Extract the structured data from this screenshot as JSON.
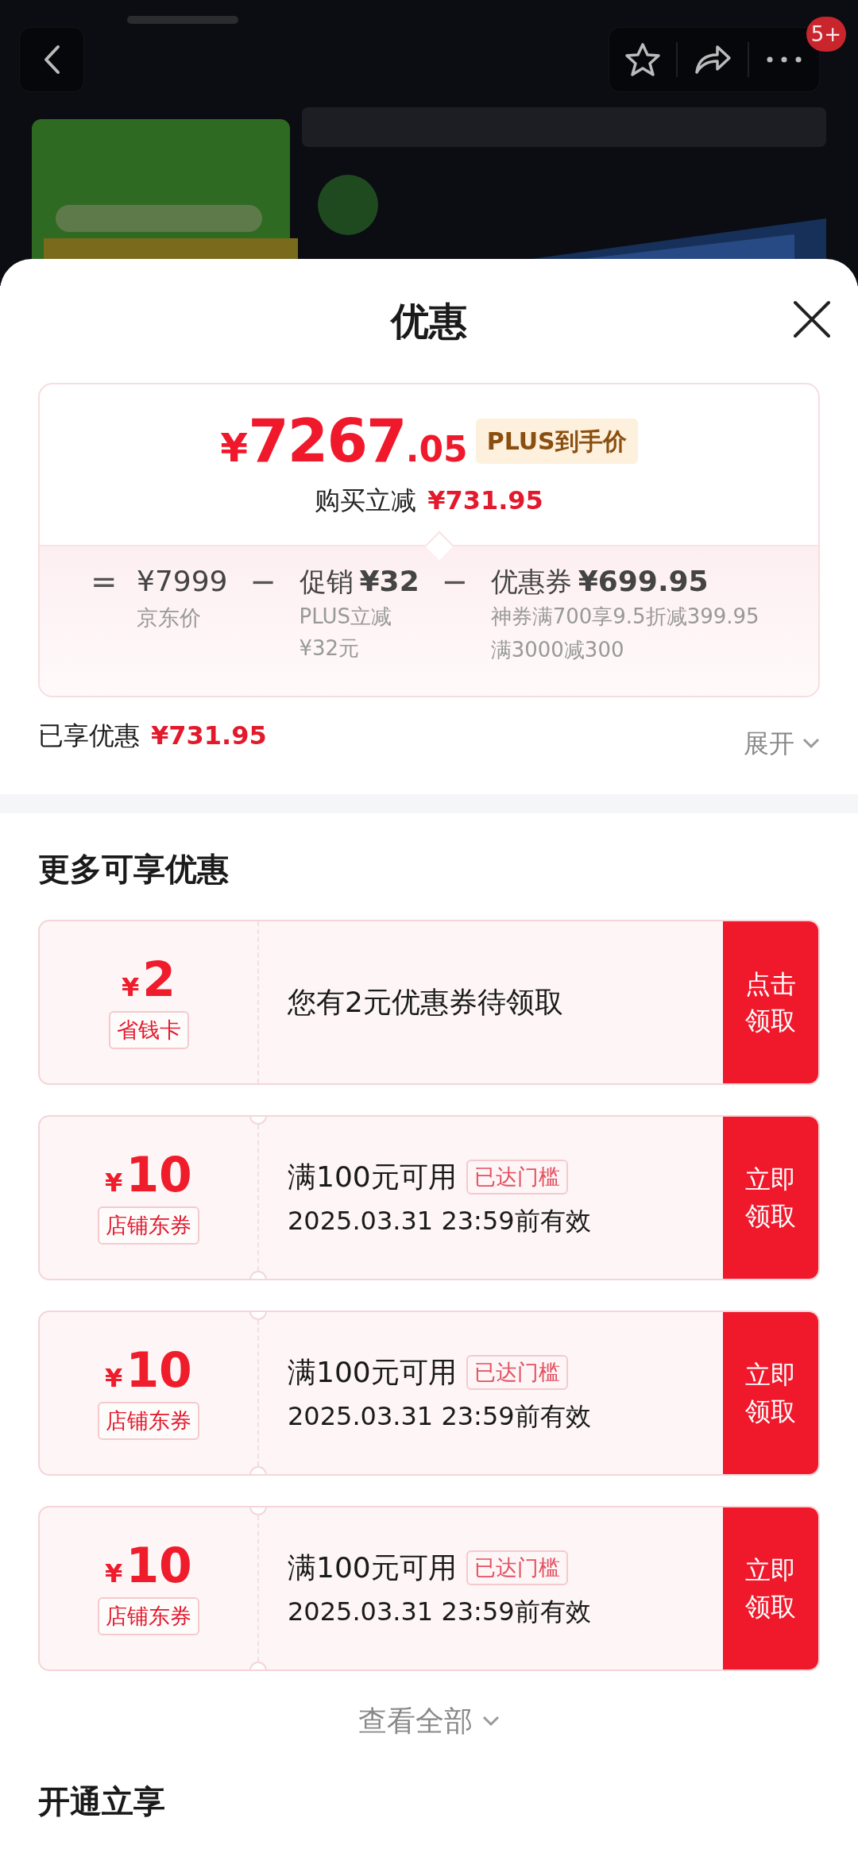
{
  "header": {
    "badge": "5+"
  },
  "sheet": {
    "title": "优惠",
    "price": {
      "currency": "¥",
      "integer": "7267",
      "decimal": ".05",
      "tag": "PLUS到手价",
      "reduction_label": "购买立减",
      "reduction": "¥731.95"
    },
    "breakdown": [
      {
        "kind": "base",
        "operator": "=",
        "value": "¥7999",
        "label": "京东价"
      },
      {
        "kind": "discount",
        "operator": "−",
        "name": "促销",
        "value": "¥32",
        "details": [
          "PLUS立减 ¥32元"
        ]
      },
      {
        "kind": "discount",
        "operator": "−",
        "name": "优惠券",
        "value": "¥699.95",
        "details": [
          "神券满700享9.5折减399.95",
          "满3000减300"
        ]
      }
    ],
    "enjoyed_label": "已享优惠",
    "enjoyed": "¥731.95",
    "expand": "展开"
  },
  "more": {
    "title": "更多可享优惠",
    "coupons": [
      {
        "kind": "savings_card",
        "currency": "¥",
        "amount": "2",
        "label": "省钱卡",
        "title": "您有2元优惠券待领取",
        "button": "点击领取"
      },
      {
        "kind": "store_coupon",
        "currency": "¥",
        "amount": "10",
        "label": "店铺东券",
        "title": "满100元可用",
        "tag": "已达门槛",
        "validity": "2025.03.31 23:59前有效",
        "button": "立即领取"
      },
      {
        "kind": "store_coupon",
        "currency": "¥",
        "amount": "10",
        "label": "店铺东券",
        "title": "满100元可用",
        "tag": "已达门槛",
        "validity": "2025.03.31 23:59前有效",
        "button": "立即领取"
      },
      {
        "kind": "store_coupon",
        "currency": "¥",
        "amount": "10",
        "label": "店铺东券",
        "title": "满100元可用",
        "tag": "已达门槛",
        "validity": "2025.03.31 23:59前有效",
        "button": "立即领取"
      }
    ],
    "view_all": "查看全部"
  },
  "next_section": {
    "title": "开通立享"
  }
}
